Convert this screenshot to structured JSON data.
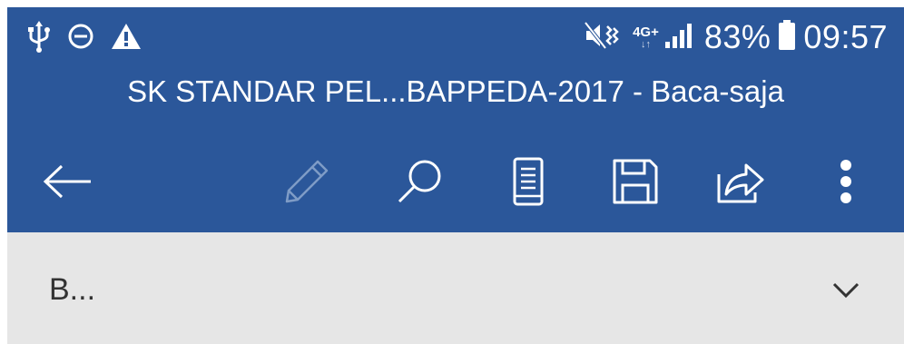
{
  "status_bar": {
    "left_icons": [
      "usb-icon",
      "do-not-disturb-icon",
      "warning-icon"
    ],
    "network_type": "4G+",
    "battery_percent": "83%",
    "time": "09:57"
  },
  "header": {
    "document_title": "SK STANDAR PEL...BAPPEDA-2017 - Baca-saja"
  },
  "toolbar": {
    "icons": [
      "back-arrow-icon",
      "edit-pencil-icon",
      "search-icon",
      "mobile-view-icon",
      "save-icon",
      "share-icon",
      "more-options-icon"
    ]
  },
  "filter": {
    "label": "B..."
  },
  "colors": {
    "header_bg": "#2b579a",
    "content_bg": "#e6e6e6",
    "icon_disabled": "#7f9cc6"
  }
}
